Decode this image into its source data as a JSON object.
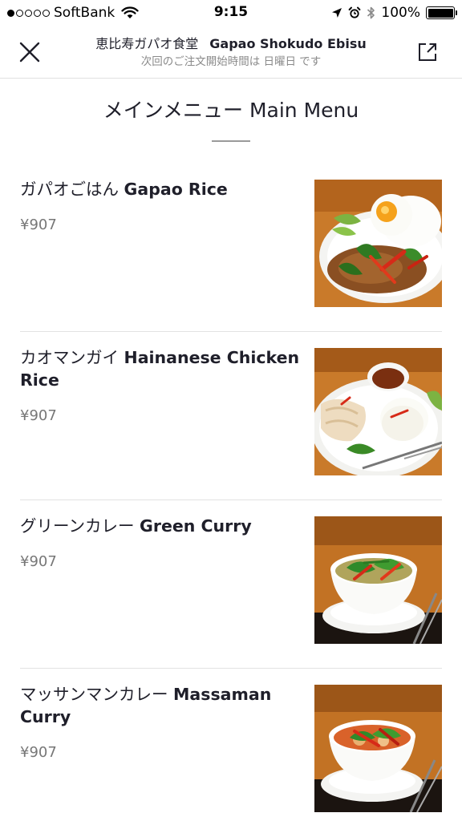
{
  "status_bar": {
    "carrier": "SoftBank",
    "signal_strength": "1 of 5 dots filled",
    "time": "9:15",
    "battery": "100%"
  },
  "header": {
    "title_ja": "恵比寿ガパオ食堂",
    "title_en": "Gapao Shokudo Ebisu",
    "subtitle": "次回のご注文開始時間は 日曜日 です",
    "close_icon": "close-icon",
    "share_icon": "share-icon"
  },
  "section": {
    "title": "メインメニュー Main Menu"
  },
  "menu": [
    {
      "name_ja": "ガパオごはん",
      "name_en": "Gapao Rice",
      "price": "¥907",
      "photo": "gapao-rice-photo"
    },
    {
      "name_ja": "カオマンガイ",
      "name_en": "Hainanese Chicken Rice",
      "price": "¥907",
      "photo": "chicken-rice-photo"
    },
    {
      "name_ja": "グリーンカレー",
      "name_en": "Green Curry",
      "price": "¥907",
      "photo": "green-curry-photo"
    },
    {
      "name_ja": "マッサンマンカレー",
      "name_en": "Massaman Curry",
      "price": "¥907",
      "photo": "massaman-curry-photo"
    }
  ],
  "colors": {
    "text": "#1f1f2a",
    "muted": "#8a8a8a",
    "price": "#777777",
    "divider": "#e2e2e2",
    "photo_background": "#c97a2a"
  }
}
